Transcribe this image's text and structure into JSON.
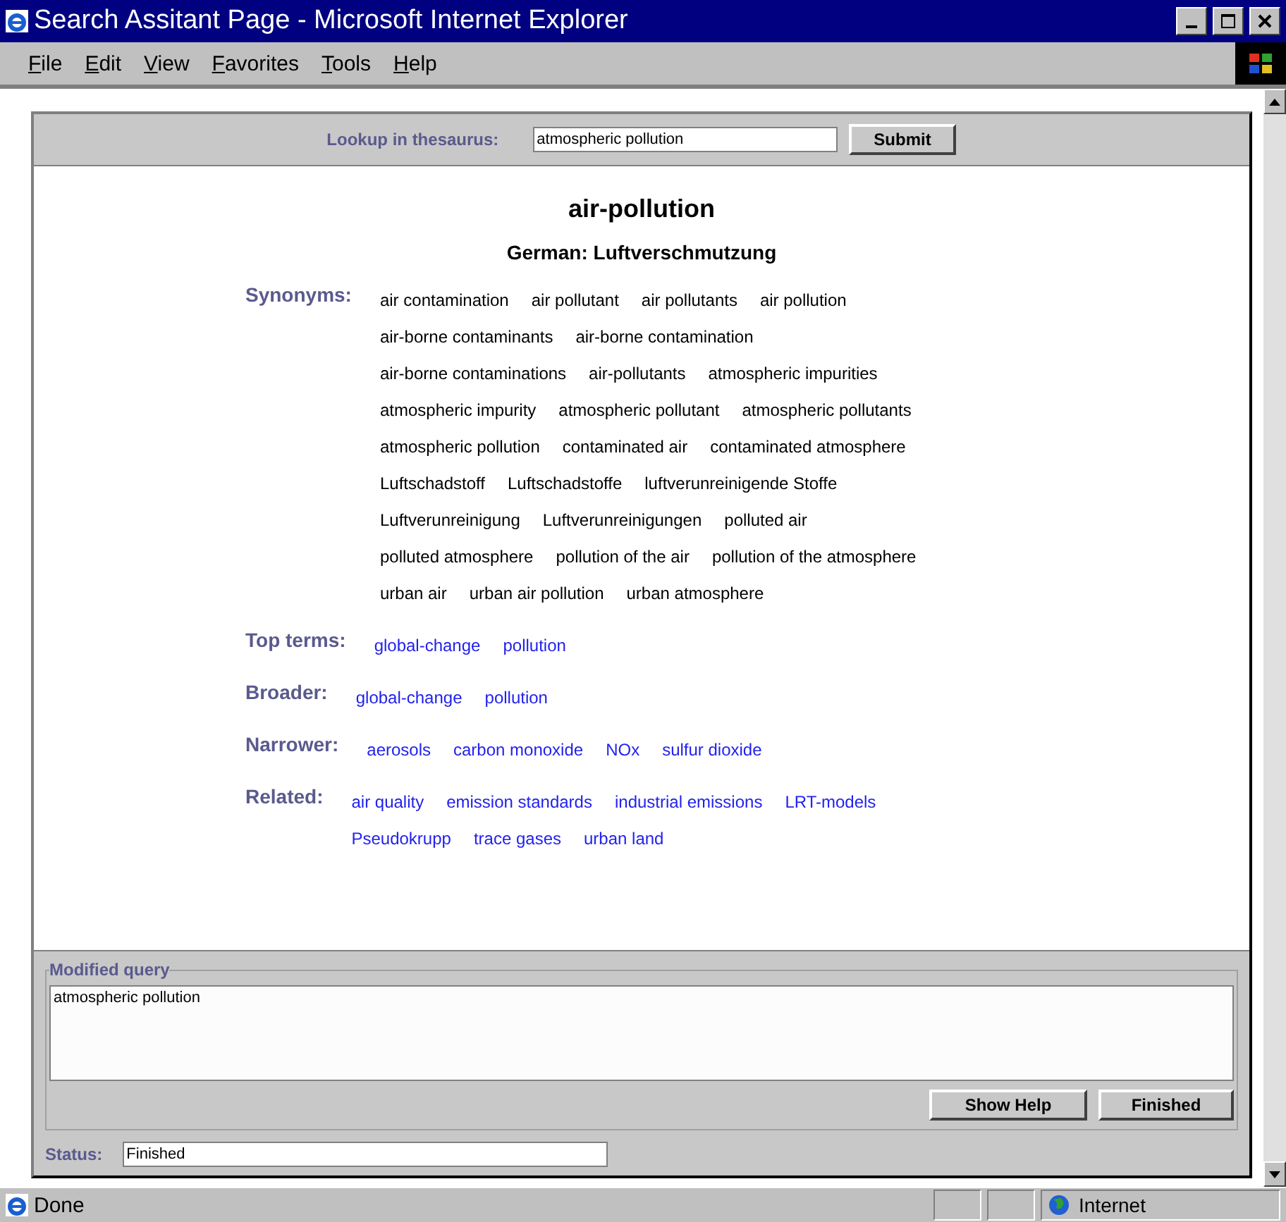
{
  "window": {
    "title": "Search Assitant Page - Microsoft Internet Explorer"
  },
  "menu": [
    "File",
    "Edit",
    "View",
    "Favorites",
    "Tools",
    "Help"
  ],
  "lookup": {
    "label": "Lookup in thesaurus:",
    "value": "atmospheric pollution",
    "button": "Submit"
  },
  "term": {
    "title": "air-pollution",
    "translation": "German: Luftverschmutzung"
  },
  "sections": [
    {
      "kind": "plain",
      "label": "Synonyms:",
      "lines": [
        [
          "air contamination",
          "air pollutant",
          "air pollutants",
          "air pollution"
        ],
        [
          "air-borne contaminants",
          "air-borne contamination"
        ],
        [
          "air-borne contaminations",
          "air-pollutants",
          "atmospheric impurities"
        ],
        [
          "atmospheric impurity",
          "atmospheric pollutant",
          "atmospheric pollutants"
        ],
        [
          "atmospheric pollution",
          "contaminated air",
          "contaminated atmosphere"
        ],
        [
          "Luftschadstoff",
          "Luftschadstoffe",
          "luftverunreinigende Stoffe"
        ],
        [
          "Luftverunreinigung",
          "Luftverunreinigungen",
          "polluted air"
        ],
        [
          "polluted atmosphere",
          "pollution of the air",
          "pollution of the atmosphere"
        ],
        [
          "urban air",
          "urban air pollution",
          "urban atmosphere"
        ]
      ]
    },
    {
      "kind": "link",
      "label": "Top terms:",
      "lines": [
        [
          "global-change",
          "pollution"
        ]
      ]
    },
    {
      "kind": "link",
      "label": "Broader:",
      "lines": [
        [
          "global-change",
          "pollution"
        ]
      ]
    },
    {
      "kind": "link",
      "label": "Narrower:",
      "lines": [
        [
          "aerosols",
          "carbon monoxide",
          "NOx",
          "sulfur dioxide"
        ]
      ]
    },
    {
      "kind": "link",
      "label": "Related:",
      "lines": [
        [
          "air quality",
          "emission standards",
          "industrial emissions",
          "LRT-models"
        ],
        [
          "Pseudokrupp",
          "trace gases",
          "urban land"
        ]
      ]
    }
  ],
  "modified_query": {
    "legend": "Modified query",
    "value": "atmospheric pollution"
  },
  "buttons": [
    "Show Help",
    "Finished"
  ],
  "status": {
    "label": "Status:",
    "value": "Finished"
  },
  "status_bar": {
    "text": "Done",
    "zone": "Internet"
  }
}
